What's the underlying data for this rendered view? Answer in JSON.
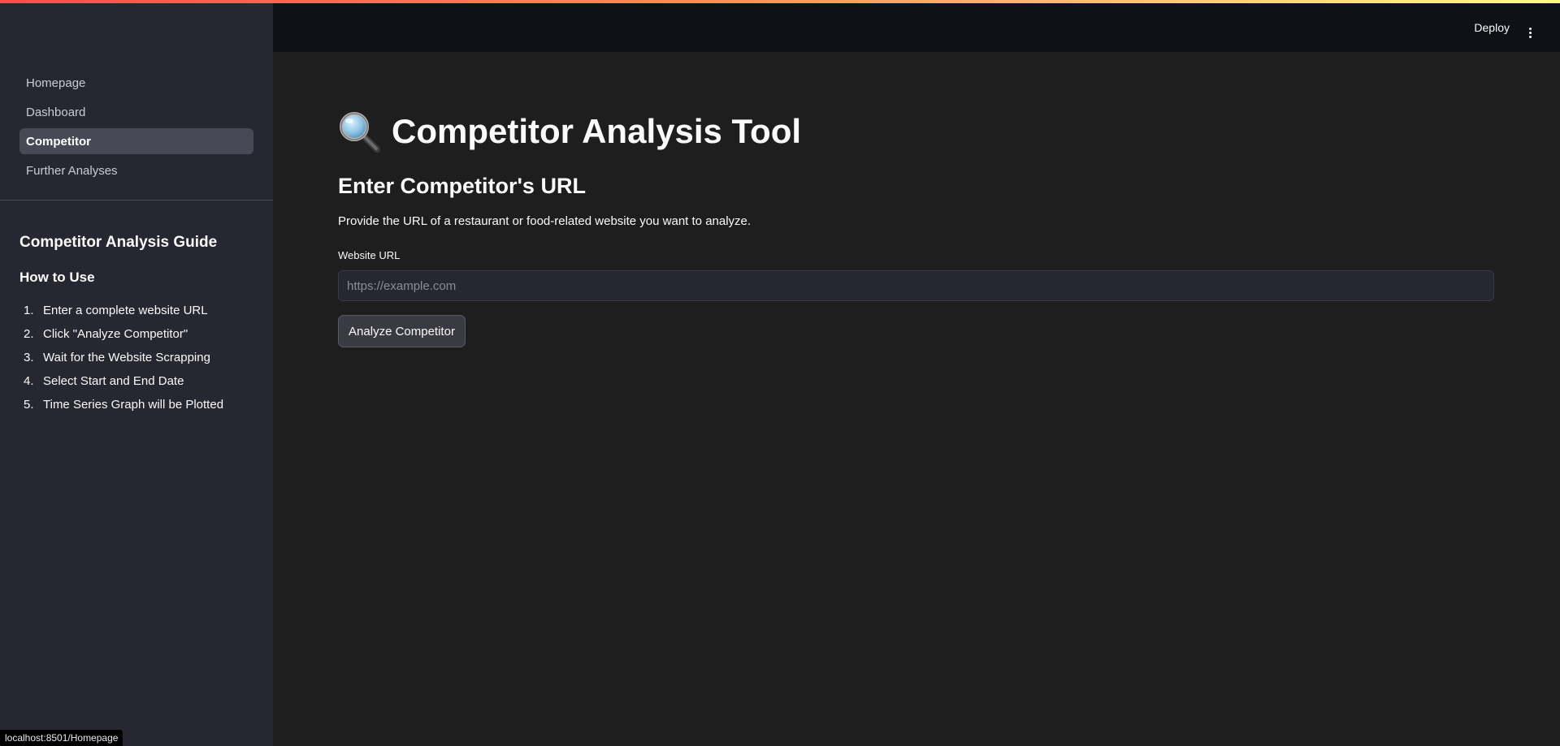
{
  "header": {
    "deploy_label": "Deploy"
  },
  "sidebar": {
    "nav": [
      {
        "label": "Homepage",
        "active": false
      },
      {
        "label": "Dashboard",
        "active": false
      },
      {
        "label": "Competitor",
        "active": true
      },
      {
        "label": "Further Analyses",
        "active": false
      }
    ],
    "guide_title": "Competitor Analysis Guide",
    "howto_title": "How to Use",
    "steps": [
      {
        "num": "1.",
        "text": "Enter a complete website URL"
      },
      {
        "num": "2.",
        "text": "Click \"Analyze Competitor\""
      },
      {
        "num": "3.",
        "text": "Wait for the Website Scrapping"
      },
      {
        "num": "4.",
        "text": "Select Start and End Date"
      },
      {
        "num": "5.",
        "text": "Time Series Graph will be Plotted"
      }
    ]
  },
  "main": {
    "title_icon": "magnifying-glass-icon",
    "title": "Competitor Analysis Tool",
    "subtitle": "Enter Competitor's URL",
    "description": "Provide the URL of a restaurant or food-related website you want to analyze.",
    "input_label": "Website URL",
    "input_value": "",
    "input_placeholder": "https://example.com",
    "button_label": "Analyze Competitor"
  },
  "status_bar": {
    "link_preview": "localhost:8501/Homepage"
  },
  "colors": {
    "accent_gradient_start": "#ff4b4b",
    "accent_gradient_end": "#fffd80",
    "sidebar_bg": "#262730",
    "main_bg": "#1e1e1e",
    "header_bg": "#0e1117"
  }
}
